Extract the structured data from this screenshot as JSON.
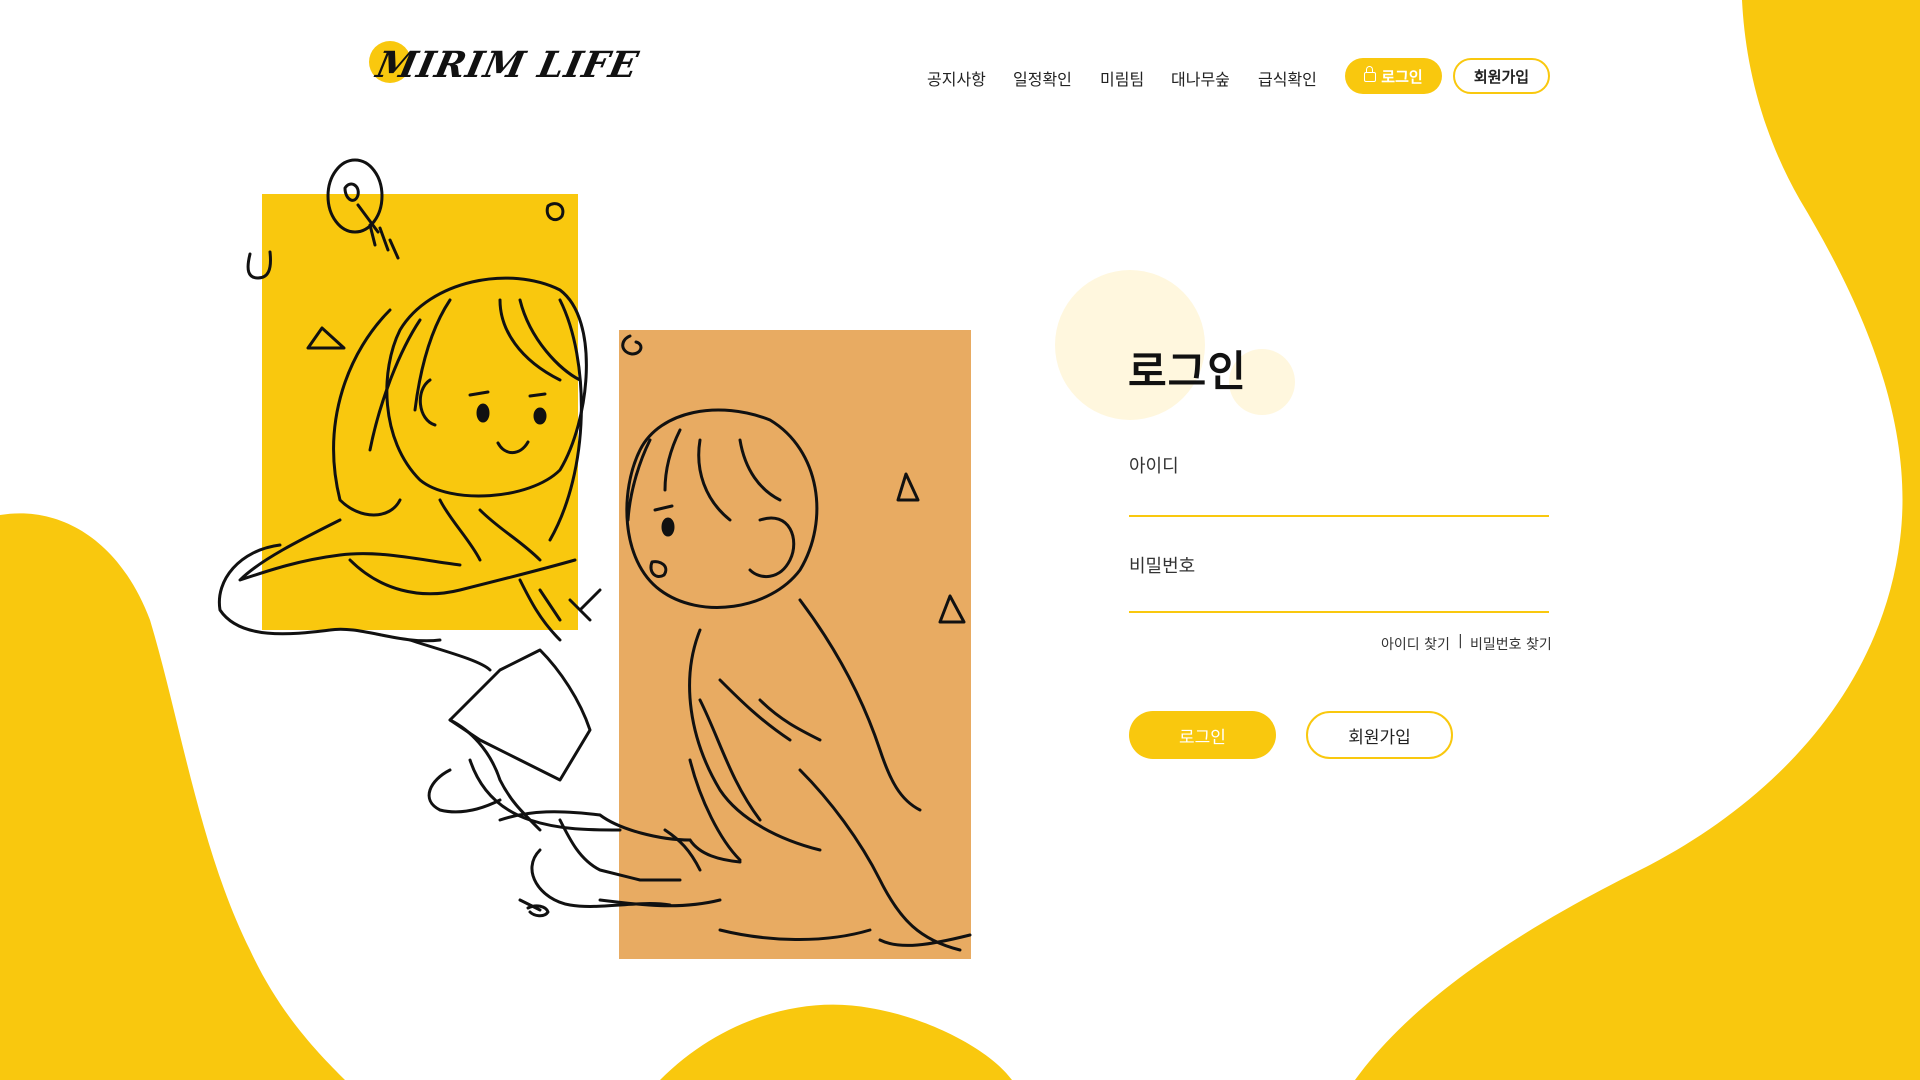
{
  "brand": {
    "logo_text": "MIRIM LIFE",
    "accent": "#f9c80e",
    "peach": "#e8ab62"
  },
  "nav": {
    "links": [
      "공지사항",
      "일정확인",
      "미림팀",
      "대나무숲",
      "급식확인"
    ],
    "login_label": "로그인",
    "signup_label": "회원가입"
  },
  "form": {
    "title": "로그인",
    "id_label": "아이디",
    "password_label": "비밀번호",
    "find_id": "아이디 찾기",
    "separator": "|",
    "find_password": "비밀번호 찾기",
    "submit_label": "로그인",
    "signup_label": "회원가입"
  },
  "illustration": {
    "subject": "two students sketch"
  }
}
